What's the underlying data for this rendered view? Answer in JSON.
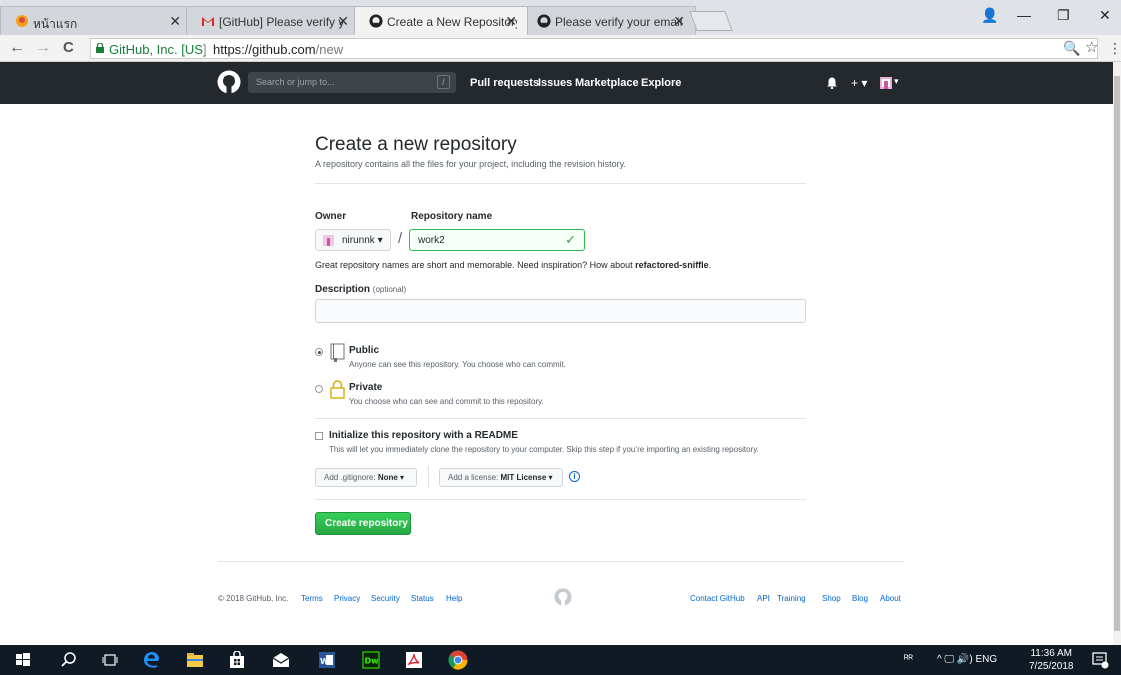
{
  "browser": {
    "tabs": [
      {
        "title": "หน้าแรก",
        "icon": "thai-site-icon"
      },
      {
        "title": "[GitHub] Please verify you",
        "icon": "gmail-icon"
      },
      {
        "title": "Create a New Repository",
        "icon": "github-icon"
      },
      {
        "title": "Please verify your email a",
        "icon": "github-icon"
      }
    ],
    "close_glyph": "✕",
    "address": {
      "site_label": "GitHub, Inc. [US]",
      "separator": "|",
      "url_host": "https://github.com",
      "url_path": "/new"
    },
    "nav": {
      "back": "←",
      "forward": "→",
      "reload": "C"
    },
    "window_controls": {
      "account": "👤",
      "minimize": "—",
      "maximize": "❐",
      "close": "✕"
    },
    "toolbar_right": {
      "zoom": "🔍",
      "star": "☆",
      "menu": "⋮"
    }
  },
  "github_header": {
    "search_placeholder": "Search or jump to...",
    "search_key": "/",
    "nav_items": [
      "Pull requests",
      "Issues",
      "Marketplace",
      "Explore"
    ],
    "bell": "🔔",
    "plus": "+ ▾",
    "avatar_caret": "▾"
  },
  "form": {
    "title": "Create a new repository",
    "subtitle": "A repository contains all the files for your project, including the revision history.",
    "owner_label": "Owner",
    "owner_value": "nirunnk ▾",
    "slash": "/",
    "repo_label": "Repository name",
    "repo_value": "work2",
    "repo_valid": "✓",
    "hint_prefix": "Great repository names are short and memorable. Need inspiration? How about ",
    "hint_suggestion": "refactored-sniffle",
    "hint_suffix": ".",
    "description_label": "Description",
    "description_optional": "(optional)",
    "description_value": "",
    "visibility": [
      {
        "title": "Public",
        "desc": "Anyone can see this repository. You choose who can commit.",
        "selected": true
      },
      {
        "title": "Private",
        "desc": "You choose who can see and commit to this repository.",
        "selected": false
      }
    ],
    "readme_label": "Initialize this repository with a README",
    "readme_desc": "This will let you immediately clone the repository to your computer. Skip this step if you’re importing an existing repository.",
    "readme_checked": false,
    "gitignore_prefix": "Add .gitignore: ",
    "gitignore_value": "None ▾",
    "license_prefix": "Add a license: ",
    "license_value": "MIT License ▾",
    "info_glyph": "i",
    "submit_label": "Create repository"
  },
  "footer": {
    "copyright": "© 2018 GitHub, Inc.",
    "left_links": [
      "Terms",
      "Privacy",
      "Security",
      "Status",
      "Help"
    ],
    "right_links": [
      "Contact GitHub",
      "API",
      "Training",
      "Shop",
      "Blog",
      "About"
    ]
  },
  "taskbar": {
    "apps": [
      "windows-start",
      "search",
      "task-view",
      "edge",
      "file-explorer",
      "store",
      "mail",
      "word",
      "dreamweaver",
      "acrobat",
      "chrome"
    ],
    "tray_people": "ᴿᴿ",
    "tray_icons": "^ 🖵 🔊) ENG",
    "time": "11:36 AM",
    "date": "7/25/2018"
  },
  "colors": {
    "github_header": "#24292e",
    "create_button": "#28a745",
    "link": "#0366d6",
    "taskbar": "#0f1a24"
  }
}
